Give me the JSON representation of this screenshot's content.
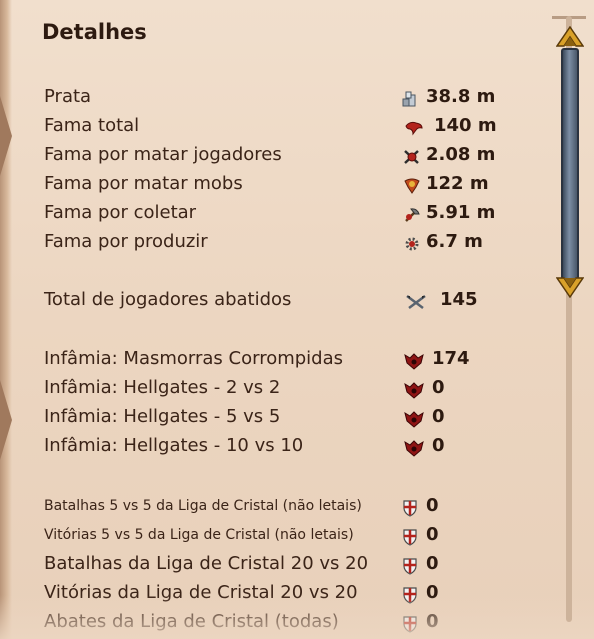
{
  "title": "Detalhes",
  "rows": [
    {
      "label": "Prata",
      "value": "38.8 m",
      "icon": "silver-icon"
    },
    {
      "label": "Fama total",
      "value": "140 m",
      "icon": "fame-icon"
    },
    {
      "label": "Fama por matar jogadores",
      "value": "2.08 m",
      "icon": "pvp-fame-icon"
    },
    {
      "label": "Fama por matar mobs",
      "value": "122 m",
      "icon": "pve-fame-icon"
    },
    {
      "label": "Fama por coletar",
      "value": "5.91 m",
      "icon": "gathering-fame-icon"
    },
    {
      "label": "Fama por produzir",
      "value": "6.7 m",
      "icon": "crafting-fame-icon"
    },
    {
      "label": "Total de jogadores abatidos",
      "value": "145",
      "icon": "crossed-swords-icon"
    },
    {
      "label": "Infâmia: Masmorras Corrompidas",
      "value": "174",
      "icon": "infamy-icon"
    },
    {
      "label": "Infâmia: Hellgates - 2 vs 2",
      "value": "0",
      "icon": "infamy-icon"
    },
    {
      "label": "Infâmia: Hellgates - 5 vs 5",
      "value": "0",
      "icon": "infamy-icon"
    },
    {
      "label": "Infâmia: Hellgates - 10 vs 10",
      "value": "0",
      "icon": "infamy-icon"
    },
    {
      "label": "Batalhas 5 vs 5 da Liga de Cristal (não letais)",
      "value": "0",
      "icon": "crystal-shield-icon"
    },
    {
      "label": "Vitórias 5 vs 5 da Liga de Cristal (não letais)",
      "value": "0",
      "icon": "crystal-shield-icon"
    },
    {
      "label": "Batalhas da Liga de Cristal 20 vs 20",
      "value": "0",
      "icon": "crystal-shield-icon"
    },
    {
      "label": "Vitórias da Liga de Cristal 20 vs 20",
      "value": "0",
      "icon": "crystal-shield-icon"
    },
    {
      "label": "Abates da Liga de Cristal (todas)",
      "value": "0",
      "icon": "crystal-shield-icon"
    }
  ],
  "colors": {
    "background": "#ecd6c1",
    "text": "#3b2418",
    "fame_red": "#b3231c",
    "infamy_red": "#8e1414",
    "scroll_blue": "#5a6b82",
    "scroll_gold": "#d9a12a"
  }
}
